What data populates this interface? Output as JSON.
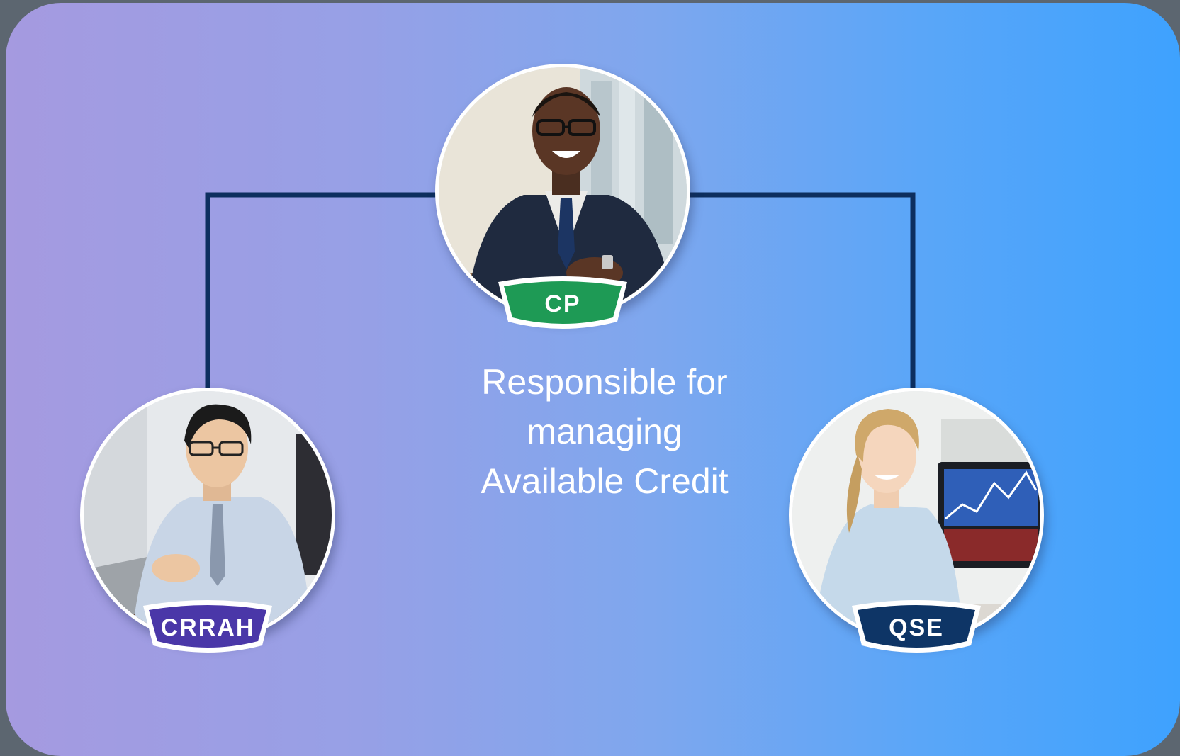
{
  "nodes": {
    "top": {
      "label": "CP",
      "badge_color": "#1e9a55"
    },
    "left": {
      "label": "CRRAH",
      "badge_color": "#4a37a8"
    },
    "right": {
      "label": "QSE",
      "badge_color": "#0e3566"
    }
  },
  "description": {
    "line1": "Responsible for",
    "line2": "managing",
    "line3": "Available Credit"
  },
  "colors": {
    "connector": "#0d2f5f",
    "gradient_start": "#a59ae0",
    "gradient_end": "#3ea2fe"
  },
  "icons": {
    "top_photo": "businessman-portrait-icon",
    "left_photo": "office-worker-portrait-icon",
    "right_photo": "analyst-portrait-icon"
  }
}
